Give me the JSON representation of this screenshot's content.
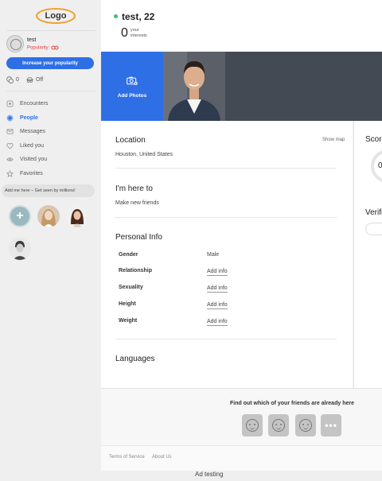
{
  "sidebar": {
    "logo": "Logo",
    "user_name": "test",
    "popularity_label": "Popularity:",
    "increase_button": "Increase your popularity",
    "credits": "0",
    "invisible_status": "Off",
    "nav": [
      {
        "label": "Encounters",
        "icon": "encounters-icon",
        "active": false
      },
      {
        "label": "People",
        "icon": "people-icon",
        "active": true
      },
      {
        "label": "Messages",
        "icon": "messages-icon",
        "active": false
      },
      {
        "label": "Liked you",
        "icon": "heart-icon",
        "active": false
      },
      {
        "label": "Visited you",
        "icon": "eye-icon",
        "active": false
      },
      {
        "label": "Favorites",
        "icon": "star-icon",
        "active": false
      }
    ],
    "add_me_text": "Add me here – Get seen by millions!"
  },
  "profile": {
    "name_age": "test, 22",
    "interests_count": "0",
    "interests_label": "your interests",
    "add_photos": "Add Photos"
  },
  "location": {
    "title": "Location",
    "value": "Houston, United States",
    "show_map": "Show map"
  },
  "here_to": {
    "title": "I'm here to",
    "value": "Make new friends"
  },
  "personal_info": {
    "title": "Personal Info",
    "rows": [
      {
        "label": "Gender",
        "value": "Male",
        "link": false
      },
      {
        "label": "Relationship",
        "value": "Add info",
        "link": true
      },
      {
        "label": "Sexuality",
        "value": "Add info",
        "link": true
      },
      {
        "label": "Height",
        "value": "Add info",
        "link": true
      },
      {
        "label": "Weight",
        "value": "Add info",
        "link": true
      }
    ]
  },
  "languages": {
    "title": "Languages"
  },
  "score": {
    "title": "Score",
    "value": "0"
  },
  "verification": {
    "title": "Verifi"
  },
  "friends": {
    "title": "Find out which of your friends are already here"
  },
  "footer": {
    "terms": "Terms of Service",
    "about": "About Us"
  },
  "ad_label": "Ad testing",
  "colors": {
    "accent": "#2f6fe6",
    "online": "#3ac26e",
    "popularity": "#e04040"
  }
}
